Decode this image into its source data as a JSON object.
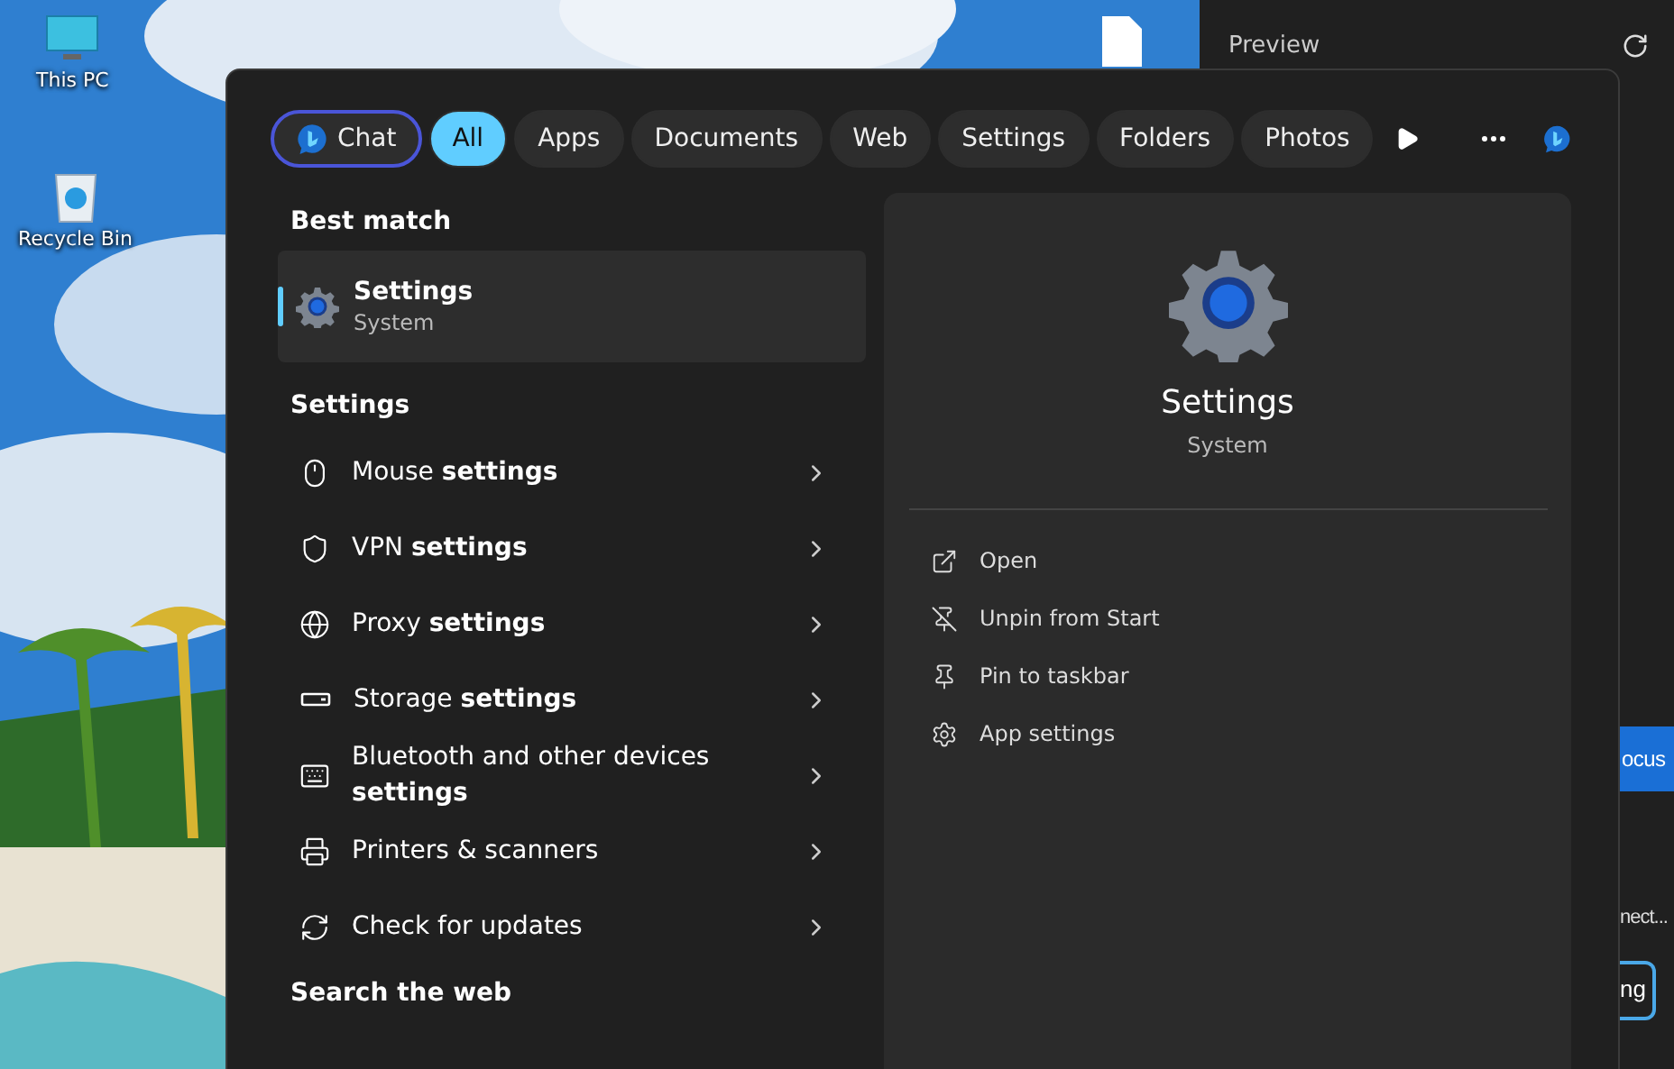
{
  "desktop": {
    "icons": [
      {
        "kind": "pc",
        "label": "This PC"
      },
      {
        "kind": "bin",
        "label": "Recycle Bin"
      },
      {
        "kind": "file"
      }
    ]
  },
  "background_app": {
    "title": "Preview",
    "items": [
      {
        "kind": "primary",
        "label": "ocus"
      },
      {
        "kind": "text",
        "label": "nect..."
      },
      {
        "kind": "outline",
        "label": "ng"
      }
    ]
  },
  "search": {
    "filters": [
      {
        "kind": "chat",
        "label": "Chat",
        "selected": false
      },
      {
        "kind": "filter",
        "label": "All",
        "selected": true
      },
      {
        "kind": "filter",
        "label": "Apps",
        "selected": false
      },
      {
        "kind": "filter",
        "label": "Documents",
        "selected": false
      },
      {
        "kind": "filter",
        "label": "Web",
        "selected": false
      },
      {
        "kind": "filter",
        "label": "Settings",
        "selected": false
      },
      {
        "kind": "filter",
        "label": "Folders",
        "selected": false
      },
      {
        "kind": "filter",
        "label": "Photos",
        "selected": false
      }
    ],
    "best_match": {
      "heading": "Best match",
      "title": "Settings",
      "subtitle": "System",
      "selected": true
    },
    "settings_section": {
      "heading": "Settings",
      "items": [
        {
          "kind": "mouse",
          "label": "Mouse **settings**"
        },
        {
          "kind": "shield",
          "label": "VPN **settings**"
        },
        {
          "kind": "globe",
          "label": "Proxy **settings**"
        },
        {
          "kind": "storage",
          "label": "Storage **settings**"
        },
        {
          "kind": "devices",
          "label": "Bluetooth and other devices **settings**"
        },
        {
          "kind": "printer",
          "label": "Printers & scanners"
        },
        {
          "kind": "sync",
          "label": "Check for updates"
        }
      ]
    },
    "web_heading": "Search the web",
    "preview": {
      "title": "Settings",
      "subtitle": "System",
      "actions": [
        {
          "kind": "open",
          "label": "Open"
        },
        {
          "kind": "unpin",
          "label": "Unpin from Start"
        },
        {
          "kind": "pin",
          "label": "Pin to taskbar"
        },
        {
          "kind": "gear",
          "label": "App settings"
        }
      ]
    }
  }
}
